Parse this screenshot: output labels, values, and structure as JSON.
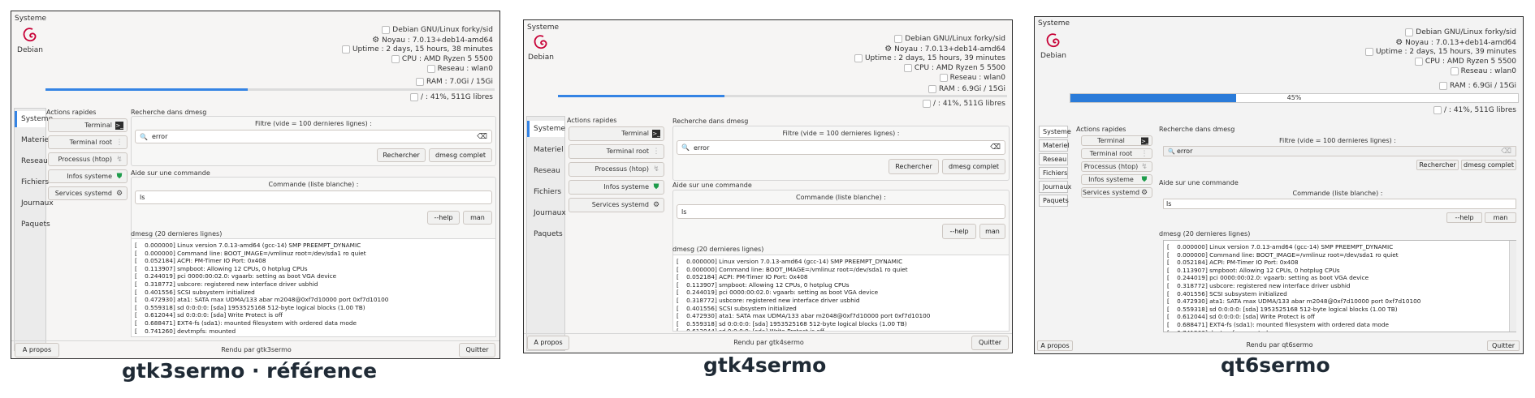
{
  "system": {
    "frame_label": "Systeme",
    "os_label": "Debian",
    "info_lines": [
      "Debian GNU/Linux forky/sid",
      "Noyau : 7.0.13+deb14-amd64",
      "Uptime : 2 days, 15 hours, 38 minutes",
      "CPU : AMD Ryzen 5 5500",
      "Reseau : wlan0",
      "RAM : 7.0Gi / 15Gi",
      "/ : 41%, 511G libres"
    ],
    "uptime_alt": "Uptime : 2 days, 15 hours, 39 minutes",
    "ram_alt": "RAM : 6.9Gi / 15Gi",
    "ram_fraction": 0.45,
    "ram_percent_label": "45%"
  },
  "sidebar": {
    "items": [
      "Systeme",
      "Materiel",
      "Reseau",
      "Fichiers",
      "Journaux",
      "Paquets"
    ]
  },
  "quick": {
    "title": "Actions rapides",
    "buttons": [
      "Terminal",
      "Terminal root",
      "Processus (htop)",
      "Infos systeme",
      "Services systemd"
    ]
  },
  "dmesg_search": {
    "title": "Recherche dans dmesg",
    "filter_label": "Filtre (vide = 100 dernieres lignes) :",
    "filter_value": "error",
    "search_button": "Rechercher",
    "full_button": "dmesg complet"
  },
  "help": {
    "title": "Aide sur une commande",
    "label": "Commande (liste blanche) :",
    "value": "ls",
    "help_button": "--help",
    "man_button": "man"
  },
  "log": {
    "title": "dmesg (20 dernieres lignes)",
    "lines": [
      "[    0.000000] Linux version 7.0.13-amd64 (gcc-14) SMP PREEMPT_DYNAMIC",
      "[    0.000000] Command line: BOOT_IMAGE=/vmlinuz root=/dev/sda1 ro quiet",
      "[    0.052184] ACPI: PM-Timer IO Port: 0x408",
      "[    0.113907] smpboot: Allowing 12 CPUs, 0 hotplug CPUs",
      "[    0.244019] pci 0000:00:02.0: vgaarb: setting as boot VGA device",
      "[    0.318772] usbcore: registered new interface driver usbhid",
      "[    0.401556] SCSI subsystem initialized",
      "[    0.472930] ata1: SATA max UDMA/133 abar m2048@0xf7d10000 port 0xf7d10100",
      "[    0.559318] sd 0:0:0:0: [sda] 1953525168 512-byte logical blocks (1.00 TB)",
      "[    0.612044] sd 0:0:0:0: [sda] Write Protect is off",
      "[    0.688471] EXT4-fs (sda1): mounted filesystem with ordered data mode",
      "[    0.741260] devtmpfs: mounted"
    ]
  },
  "footer": {
    "about_button": "A propos",
    "quit_button": "Quitter",
    "rendered": [
      "Rendu par gtk3sermo",
      "Rendu par gtk4sermo",
      "Rendu par qt6sermo"
    ]
  },
  "captions": [
    "gtk3sermo · référence",
    "gtk4sermo",
    "qt6sermo"
  ],
  "colors": {
    "accent": "#3584e4",
    "qt_progress": "#2a7bd9"
  }
}
